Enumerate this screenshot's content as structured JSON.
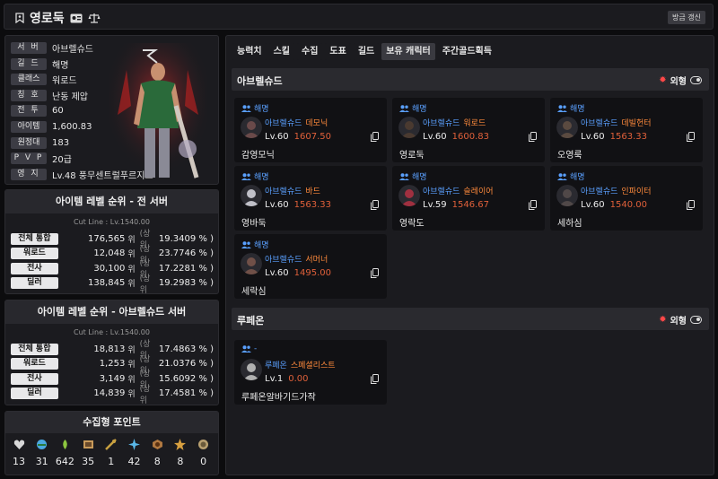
{
  "header": {
    "title": "영로둑",
    "refresh_label": "방금 갱신"
  },
  "profile": {
    "rows": [
      {
        "label": "서 버",
        "value": "아브렐슈드"
      },
      {
        "label": "길 드",
        "value": "해명"
      },
      {
        "label": "클래스",
        "value": "워로드"
      },
      {
        "label": "칭 호",
        "value": "난동 제압"
      },
      {
        "label": "전 투",
        "value": "60"
      },
      {
        "label": "아이템",
        "value": "1,600.83"
      },
      {
        "label": "원정대",
        "value": "183"
      },
      {
        "label": "P V P",
        "value": "20급"
      },
      {
        "label": "영 지",
        "value": "Lv.48 풍무센트럴푸르지오"
      }
    ]
  },
  "rank_all": {
    "title": "아이템 레벨 순위 - 전 서버",
    "cutline": "Cut Line : Lv.1540.00",
    "rows": [
      {
        "label": "전체 통합",
        "num": "176,565",
        "wi": "위",
        "sang": "(상위",
        "pct": "19.3409 % )"
      },
      {
        "label": "워로드",
        "num": "12,048",
        "wi": "위",
        "sang": "(상위",
        "pct": "23.7746 % )"
      },
      {
        "label": "전사",
        "num": "30,100",
        "wi": "위",
        "sang": "(상위",
        "pct": "17.2281 % )"
      },
      {
        "label": "딜러",
        "num": "138,845",
        "wi": "위",
        "sang": "(상위",
        "pct": "19.2983 % )"
      }
    ]
  },
  "rank_server": {
    "title": "아이템 레벨 순위 - 아브렐슈드 서버",
    "cutline": "Cut Line : Lv.1540.00",
    "rows": [
      {
        "label": "전체 통합",
        "num": "18,813",
        "wi": "위",
        "sang": "(상위",
        "pct": "17.4863 % )"
      },
      {
        "label": "워로드",
        "num": "1,253",
        "wi": "위",
        "sang": "(상위",
        "pct": "21.0376 % )"
      },
      {
        "label": "전사",
        "num": "3,149",
        "wi": "위",
        "sang": "(상위",
        "pct": "15.6092 % )"
      },
      {
        "label": "딜러",
        "num": "14,839",
        "wi": "위",
        "sang": "(상위",
        "pct": "17.4581 % )"
      }
    ]
  },
  "collect": {
    "title": "수집형 포인트",
    "items": [
      {
        "icon": "giant-heart-icon",
        "color": "#d8d8d8",
        "count": "13"
      },
      {
        "icon": "island-heart-icon",
        "color": "#4aa8e0",
        "count": "31"
      },
      {
        "icon": "mokoko-seed-icon",
        "color": "#8cc63f",
        "count": "642"
      },
      {
        "icon": "art-painting-icon",
        "color": "#c89a5a",
        "count": "35"
      },
      {
        "icon": "voyage-icon",
        "color": "#c8a040",
        "count": "1"
      },
      {
        "icon": "world-tree-leaf-icon",
        "color": "#5ab8e8",
        "count": "42"
      },
      {
        "icon": "ignea-token-icon",
        "color": "#b07840",
        "count": "8"
      },
      {
        "icon": "orpheus-star-icon",
        "color": "#d8a040",
        "count": "8"
      },
      {
        "icon": "sea-bounty-icon",
        "color": "#b8a070",
        "count": "0"
      }
    ]
  },
  "tabs": [
    {
      "label": "능력치",
      "active": false
    },
    {
      "label": "스킬",
      "active": false
    },
    {
      "label": "수집",
      "active": false
    },
    {
      "label": "도표",
      "active": false
    },
    {
      "label": "길드",
      "active": false
    },
    {
      "label": "보유 캐릭터",
      "active": true
    },
    {
      "label": "주간골드획득",
      "active": false
    }
  ],
  "servers": [
    {
      "name": "아브렐슈드",
      "appearance_label": "외형",
      "characters": [
        {
          "guild": "해명",
          "server": "아브렐슈드",
          "class": "데모닉",
          "level": "Lv.60",
          "item_level": "1607.50",
          "nickname": "감영모닉",
          "portrait": "#6a4a4a"
        },
        {
          "guild": "해명",
          "server": "아브렐슈드",
          "class": "워로드",
          "level": "Lv.60",
          "item_level": "1600.83",
          "nickname": "영로둑",
          "portrait": "#4a3a30"
        },
        {
          "guild": "해명",
          "server": "아브렐슈드",
          "class": "데빌헌터",
          "level": "Lv.60",
          "item_level": "1563.33",
          "nickname": "오영룩",
          "portrait": "#5a4a40"
        },
        {
          "guild": "해명",
          "server": "아브렐슈드",
          "class": "바드",
          "level": "Lv.60",
          "item_level": "1563.33",
          "nickname": "영바둑",
          "portrait": "#c0c0c8"
        },
        {
          "guild": "해명",
          "server": "아브렐슈드",
          "class": "슬레이어",
          "level": "Lv.59",
          "item_level": "1546.67",
          "nickname": "영락도",
          "portrait": "#a03040"
        },
        {
          "guild": "해명",
          "server": "아브렐슈드",
          "class": "인파이터",
          "level": "Lv.60",
          "item_level": "1540.00",
          "nickname": "세하심",
          "portrait": "#504848"
        },
        {
          "guild": "해명",
          "server": "아브렐슈드",
          "class": "서머너",
          "level": "Lv.60",
          "item_level": "1495.00",
          "nickname": "세락심",
          "portrait": "#705048"
        }
      ]
    },
    {
      "name": "루페온",
      "appearance_label": "외형",
      "characters": [
        {
          "guild": "-",
          "server": "루페온",
          "class": "스페셜리스트",
          "level": "Lv.1",
          "item_level": "0.00",
          "nickname": "루페온알바기드가작",
          "portrait": "#b0b0b0"
        }
      ]
    }
  ]
}
